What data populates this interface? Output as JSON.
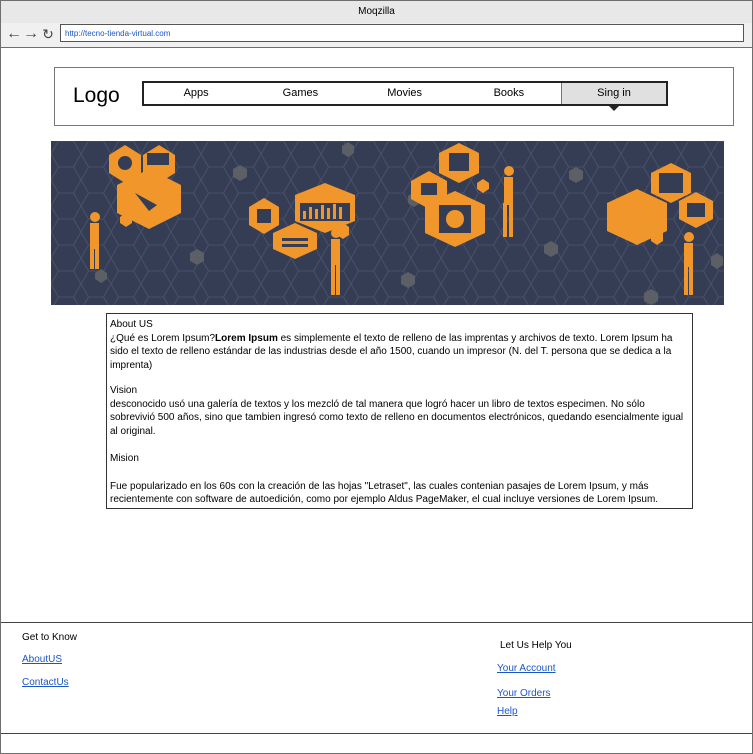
{
  "window": {
    "title": "Moqzilla"
  },
  "browser": {
    "back_icon": "arrow-left-icon",
    "forward_icon": "arrow-right-icon",
    "reload_icon": "reload-icon",
    "url": "http://tecno-tienda-virtual.com"
  },
  "header": {
    "logo": "Logo",
    "menu": [
      "Apps",
      "Games",
      "Movies",
      "Books"
    ],
    "signin": "Sing in"
  },
  "banner": {
    "colors": {
      "background": "#353d54",
      "accent": "#f0962a",
      "figure": "#f0962a"
    }
  },
  "about": {
    "title": "About US",
    "intro_start": " ¿Qué es Lorem Ipsum?",
    "intro_bold": "Lorem Ipsum",
    "intro_rest": " es simplemente el texto de relleno de las imprentas y archivos de texto. Lorem Ipsum ha sido el texto de relleno estándar de las industrias desde el año 1500, cuando un impresor (N. del T. persona que se dedica a la imprenta)",
    "vision_title": "Vision",
    "vision_text": "desconocido usó una galería de textos y los mezcló de tal manera que logró hacer un libro de textos especimen. No sólo sobrevivió 500 años, sino que tambien ingresó como texto de relleno en documentos electrónicos, quedando esencialmente igual al original.",
    "mision_title": "Mision",
    "mision_text": "Fue popularizado en los 60s con la creación de las hojas \"Letraset\", las cuales contenian pasajes de Lorem Ipsum, y más recientemente con software de autoedición, como por ejemplo Aldus PageMaker, el cual incluye versiones de Lorem Ipsum."
  },
  "footer": {
    "left_title": "Get to Know",
    "left_links": [
      "AboutUS",
      "ContactUs"
    ],
    "right_title": "Let Us Help You",
    "right_links": [
      "Your Account",
      "Your Orders",
      "Help"
    ]
  }
}
